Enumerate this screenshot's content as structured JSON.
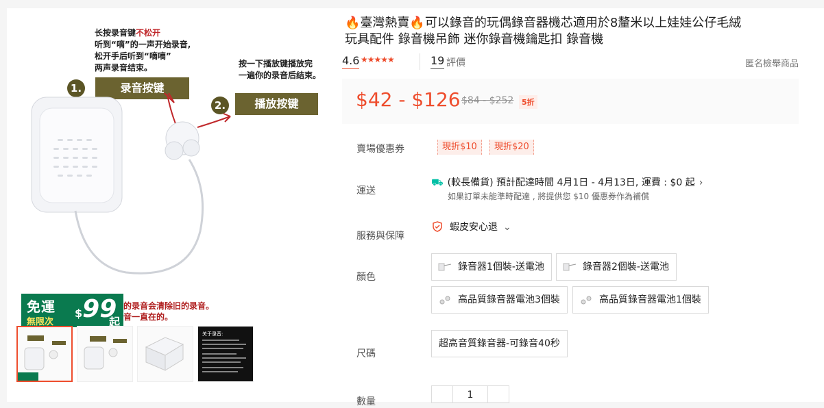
{
  "gallery": {
    "step1_text_a": "长按录音键",
    "step1_text_red": "不松开",
    "step1_text_b": "听到“嘀”的一声开始录音,",
    "step1_text_c": "松开手后听到“嘀嘀”",
    "step1_text_d": "两声录音结束。",
    "step2_text_a": "按一下播放键播放完",
    "step2_text_b": "一遍你的录音后结束。",
    "step1_num": "1.",
    "step1_btn": "录音按键",
    "step2_num": "2.",
    "step2_btn": "播放按键",
    "promo_line1": "免運",
    "promo_line2": "無限次",
    "promo_dollar": "$",
    "promo_amount": "99",
    "promo_suffix": "起",
    "bottom_text_a": "的录音会清除旧的录音。",
    "bottom_text_b": "音一直在的。",
    "thumb4_title": "关于录音:"
  },
  "product": {
    "fire_icon": "🔥",
    "title_part1": "臺灣熱賣",
    "title_part2": "可以錄音的玩偶錄音器機芯適用於8釐米以上娃娃公仔毛絨",
    "title_part3": "玩具配件 錄音機吊飾 迷你錄音機鑰匙扣 錄音機",
    "rating": "4.6",
    "review_count": "19",
    "review_label": "評價",
    "report_label": "匿名檢舉商品",
    "price": "$42 - $126",
    "old_price": "$84 - $252",
    "discount": "5折"
  },
  "rows": {
    "voucher_label": "賣場優惠券",
    "voucher1": "現折$10",
    "voucher2": "現折$20",
    "shipping_label": "運送",
    "shipping_text": "(較長備貨) 預計配達時間 4月1日 - 4月13日, 運費 : $0 起",
    "shipping_sub": "如果訂單未能準時配達 , 將提供您 $10 優惠券作為補償",
    "service_label": "服務與保障",
    "service_text": "蝦皮安心退",
    "color_label": "顏色",
    "color_options": [
      "錄音器1個裝-送電池",
      "錄音器2個裝-送電池",
      "高品質錄音器電池3個裝",
      "高品質錄音器電池1個裝"
    ],
    "size_label": "尺碼",
    "size_option": "超高音質錄音器-可錄音40秒",
    "qty_label": "數量",
    "qty_value": "1"
  },
  "colors": {
    "accent": "#ee4d2d",
    "promo_green": "#0a7a4f",
    "step_olive": "#6b6330"
  }
}
